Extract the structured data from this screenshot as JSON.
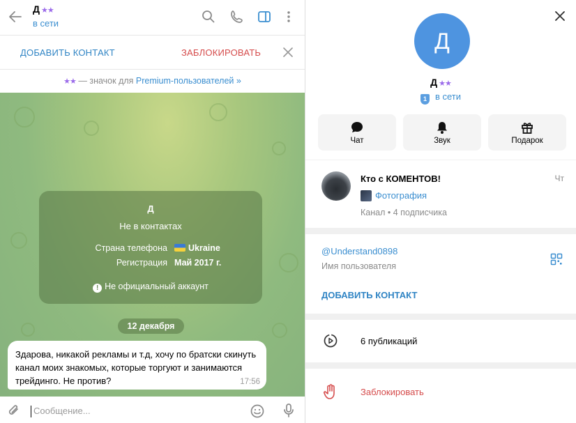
{
  "chat_header": {
    "name": "Д",
    "stars": "★★",
    "status": "в сети"
  },
  "action_bar": {
    "add_contact": "ДОБАВИТЬ КОНТАКТ",
    "block": "ЗАБЛОКИРОВАТЬ"
  },
  "premium_bar": {
    "stars": "★★",
    "text": " — значок для ",
    "link": "Premium-пользователей »"
  },
  "info_card": {
    "name": "Д",
    "subtitle": "Не в контактах",
    "phone_country_label": "Страна телефона",
    "phone_country_value": "Ukraine",
    "registration_label": "Регистрация",
    "registration_value": "Май 2017 г.",
    "warning": "Не официальный аккаунт"
  },
  "date_pill": "12 декабря",
  "message": {
    "text": "Здарова, никакой рекламы и т.д, хочу по братски скинуть канал моих знакомых, которые торгуют и занимаются трейдинго. Не против?",
    "time": "17:56"
  },
  "composer": {
    "placeholder": "Сообщение..."
  },
  "profile": {
    "avatar_letter": "Д",
    "name": "Д",
    "stars": "★★",
    "shield_number": "1",
    "status": "в сети",
    "actions": [
      {
        "label": "Чат",
        "icon": "chat-bubble-icon"
      },
      {
        "label": "Звук",
        "icon": "bell-icon"
      },
      {
        "label": "Подарок",
        "icon": "gift-icon"
      }
    ]
  },
  "channel": {
    "title": "Кто с КОМЕНТОВ!",
    "time": "Чт",
    "last_message": "Фотография",
    "meta": "Канал • 4 подписчика"
  },
  "user_info": {
    "username": "@Understand0898",
    "username_label": "Имя пользователя",
    "add_contact": "ДОБАВИТЬ КОНТАКТ"
  },
  "posts": {
    "label": "6 публикаций"
  },
  "block_row": {
    "label": "Заблокировать"
  },
  "colors": {
    "accent": "#3a8ed0",
    "danger": "#d54b4b",
    "avatar": "#4e94e0",
    "premium_star": "#9b6bea"
  }
}
